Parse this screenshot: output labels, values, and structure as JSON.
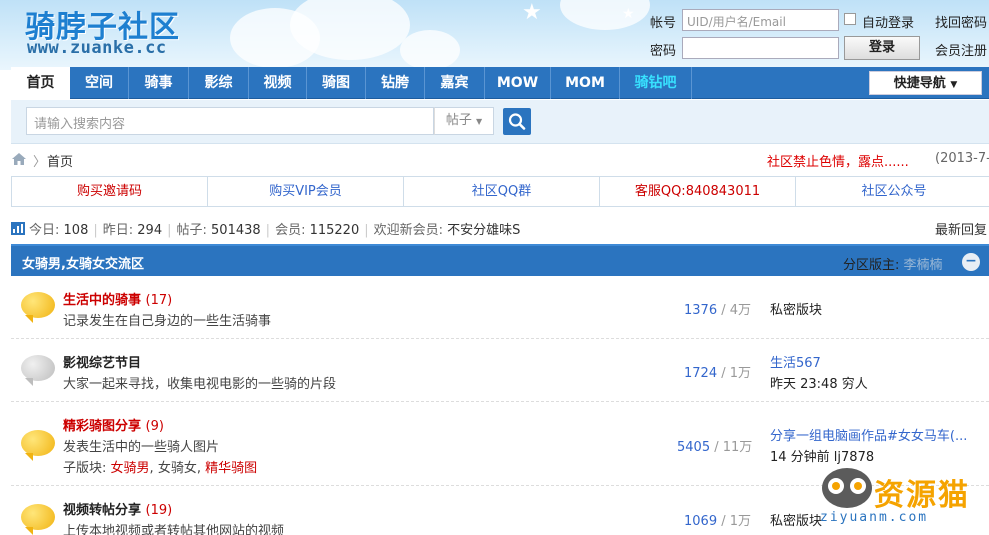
{
  "header": {
    "site_name": "骑脖子社区",
    "site_url": "www.zuanke.cc",
    "login": {
      "account_label": "帐号",
      "account_placeholder": "UID/用户名/Email",
      "auto_login": "自动登录",
      "find_password": "找回密码",
      "password_label": "密码",
      "login_button": "登录",
      "register": "会员注册"
    }
  },
  "nav": {
    "items": [
      {
        "label": "首页",
        "active": true
      },
      {
        "label": "空间"
      },
      {
        "label": "骑事"
      },
      {
        "label": "影综"
      },
      {
        "label": "视频"
      },
      {
        "label": "骑图"
      },
      {
        "label": "钻胯"
      },
      {
        "label": "嘉宾"
      },
      {
        "label": "MOW"
      },
      {
        "label": "MOM"
      },
      {
        "label": "骑钻吧",
        "highlight": "#38e1ff"
      }
    ],
    "quick_nav": "快捷导航"
  },
  "search": {
    "placeholder": "请输入搜索内容",
    "type": "帖子"
  },
  "breadcrumb": {
    "home": "首页"
  },
  "notice": {
    "text": "社区禁止色情，露点......",
    "date": "(2013-7-"
  },
  "links": [
    {
      "label": "购买邀请码",
      "color": "#c00"
    },
    {
      "label": "购买VIP会员",
      "color": "#36c"
    },
    {
      "label": "社区QQ群",
      "color": "#36c"
    },
    {
      "label": "客服QQ:840843011",
      "color": "#c00"
    },
    {
      "label": "社区公众号",
      "color": "#36c"
    }
  ],
  "stats": {
    "today_label": "今日:",
    "today": "108",
    "yesterday_label": "昨日:",
    "yesterday": "294",
    "posts_label": "帖子:",
    "posts": "501438",
    "members_label": "会员:",
    "members": "115220",
    "welcome_label": "欢迎新会员:",
    "new_member": "不安分雄味S",
    "latest_reply": "最新回复"
  },
  "section": {
    "title": "女骑男,女骑女交流区",
    "moderator_label": "分区版主:",
    "moderator": "李楠楠"
  },
  "forums": [
    {
      "name": "生活中的骑事",
      "count": "(17)",
      "name_color": "#c00",
      "icon": "yellow-bubble",
      "desc": "记录发生在自己身边的一些生活骑事",
      "threads": "1376",
      "posts": "4万",
      "last": [
        "私密版块"
      ]
    },
    {
      "name": "影视综艺节目",
      "count": "",
      "name_color": "#222",
      "icon": "gray-bubble",
      "desc": "大家一起来寻找，收集电视电影的一些骑的片段",
      "threads": "1724",
      "posts": "1万",
      "last": [
        "生活567",
        "昨天 23:48 穷人"
      ]
    },
    {
      "name": "精彩骑图分享",
      "count": "(9)",
      "name_color": "#c00",
      "icon": "yellow-bubble",
      "desc": "发表生活中的一些骑人图片",
      "sub_label": "子版块:",
      "subs": [
        "女骑男",
        "女骑女",
        "精华骑图"
      ],
      "threads": "5405",
      "posts": "11万",
      "last": [
        "分享一组电脑画作品#女女马车(...",
        "14 分钟前 lj7878"
      ]
    },
    {
      "name": "视频转帖分享",
      "count": "(19)",
      "name_color": "#222",
      "icon": "yellow-bubble",
      "desc": "上传本地视频或者转帖其他网站的视频",
      "threads": "1069",
      "posts": "1万",
      "last": [
        "私密版块"
      ]
    }
  ],
  "watermark": {
    "text": "资源猫",
    "url": "ziyuanm.com"
  }
}
